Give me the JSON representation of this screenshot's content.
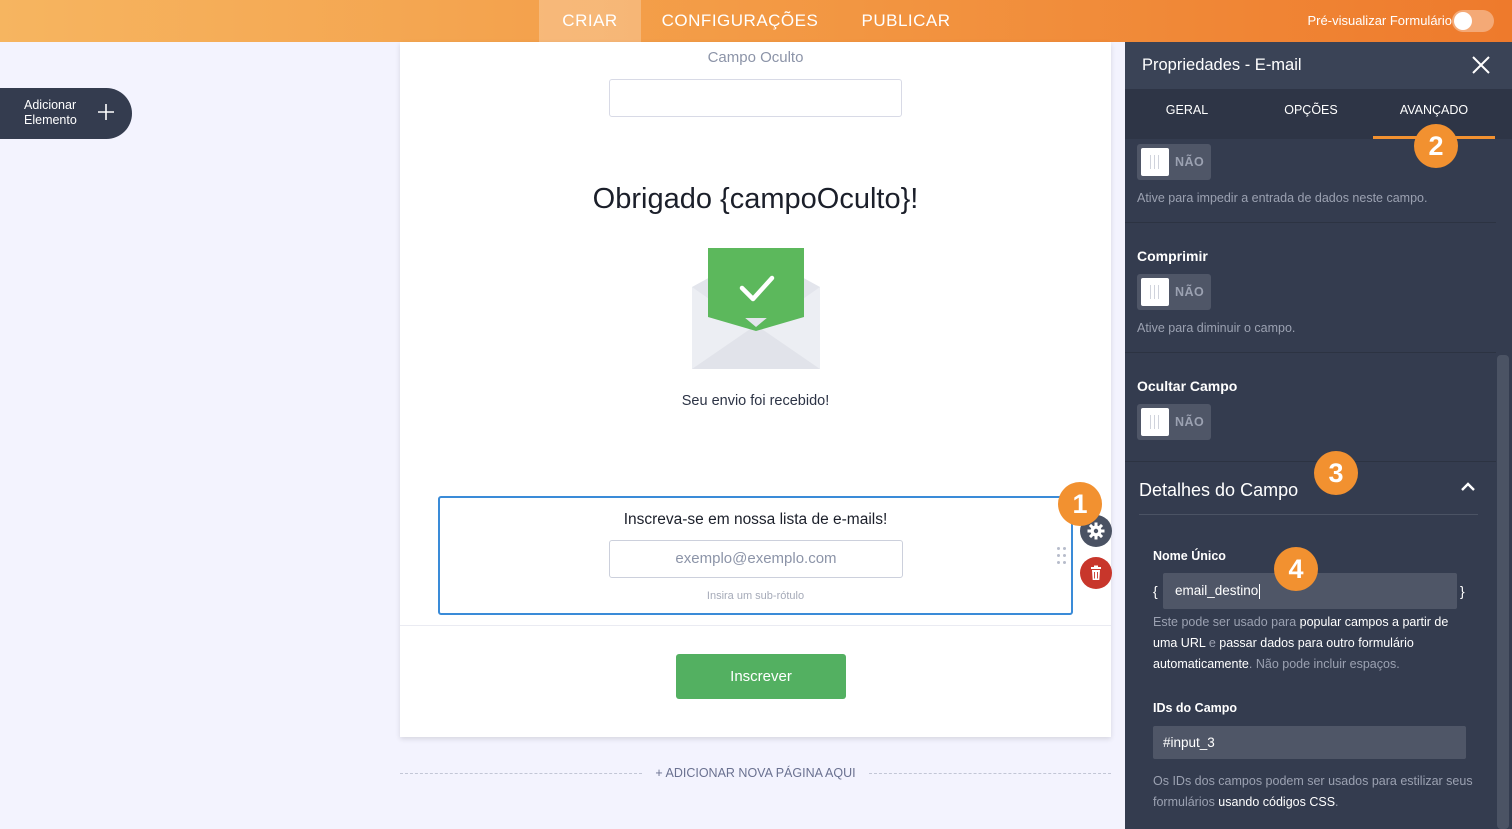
{
  "topbar": {
    "tabs": [
      "CRIAR",
      "CONFIGURAÇÕES",
      "PUBLICAR"
    ],
    "preview_label": "Pré-visualizar Formulário"
  },
  "sidebar": {
    "add_element_line1": "Adicionar",
    "add_element_line2": "Elemento"
  },
  "form": {
    "hidden_field_label": "Campo Oculto",
    "thank_you_heading": "Obrigado {campoOculto}!",
    "received_text": "Seu envio foi recebido!",
    "email_title": "Inscreva-se em nossa lista de e-mails!",
    "email_placeholder": "exemplo@exemplo.com",
    "email_sublabel": "Insira um sub-rótulo",
    "submit_label": "Inscrever",
    "add_page_label": "+ ADICIONAR NOVA PÁGINA AQUI"
  },
  "badges": [
    "1",
    "2",
    "3",
    "4"
  ],
  "panel": {
    "title": "Propriedades - E-mail",
    "tabs": [
      "GERAL",
      "OPÇÕES",
      "AVANÇADO"
    ],
    "readonly_toggle": "NÃO",
    "readonly_hint": "Ative para impedir a entrada de dados neste campo.",
    "shrink_label": "Comprimir",
    "shrink_toggle": "NÃO",
    "shrink_hint": "Ative para diminuir o campo.",
    "hide_label": "Ocultar Campo",
    "hide_toggle": "NÃO",
    "details_title": "Detalhes do Campo",
    "unique_name_label": "Nome Único",
    "brace_open": "{",
    "brace_close": "}",
    "unique_name_value": "email_destino",
    "unique_desc": {
      "p1": "Este pode ser usado para ",
      "l1": "popular campos a partir de uma URL",
      "p2": " e ",
      "l2": "passar dados para outro formulário automaticamente",
      "p3": ". Não pode incluir espaços."
    },
    "ids_label": "IDs do Campo",
    "ids_value": "#input_3",
    "ids_desc": {
      "p1": "Os IDs dos campos podem ser usados para estilizar seus formulários ",
      "l1": "usando códigos CSS",
      "p2": "."
    }
  },
  "colors": {
    "accent_orange": "#f29130",
    "panel_bg": "#343c4f",
    "submit_green": "#53b061",
    "selection_blue": "#3a8bd8",
    "delete_red": "#c8362b"
  }
}
